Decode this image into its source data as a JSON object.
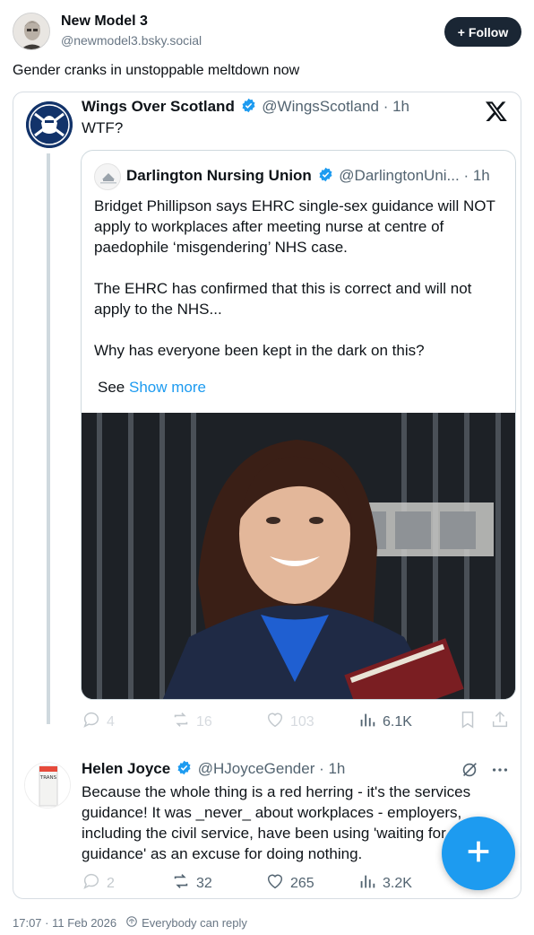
{
  "post": {
    "author_name": "New Model 3",
    "author_handle": "@newmodel3.bsky.social",
    "follow_label": "Follow",
    "text": "Gender cranks in unstoppable meltdown now",
    "timestamp": "17:07 · 11 Feb 2026",
    "reply_setting": "Everybody can reply"
  },
  "embedded_tweet": {
    "name": "Wings Over Scotland",
    "handle": "@WingsScotland",
    "age": "· 1h",
    "text": "WTF?",
    "quote": {
      "name": "Darlington Nursing Union",
      "handle": "@DarlingtonUni...",
      "age": "· 1h",
      "para1": "Bridget Phillipson says EHRC single-sex guidance will NOT apply to workplaces after meeting nurse at centre of paedophile ‘misgendering’ NHS case.",
      "para2": "The EHRC has confirmed that this is correct and will not apply to the NHS...",
      "para3": "Why has everyone been kept in the dark on this?",
      "see_label": "See",
      "show_more": "Show more"
    },
    "stats": {
      "replies": "4",
      "reposts": "16",
      "likes": "103",
      "views": "6.1K"
    }
  },
  "reply_tweet": {
    "name": "Helen Joyce",
    "handle": "@HJoyceGender",
    "age": "· 1h",
    "text": "Because the whole thing is a red herring - it's the services guidance! It was _never_ about workplaces - employers, including the civil service, have been using 'waiting for guidance' as an excuse for doing nothing.",
    "avatar_book_text": "TRANS",
    "stats": {
      "replies": "2",
      "reposts": "32",
      "likes": "265",
      "views": "3.2K"
    }
  },
  "colors": {
    "accent": "#1d9bf0",
    "follow_bg": "#1a2634",
    "muted": "#536471"
  },
  "icons": [
    "plus-icon",
    "verified-icon",
    "x-logo-icon",
    "reply-icon",
    "repost-icon",
    "like-icon",
    "views-icon",
    "bookmark-icon",
    "share-icon",
    "grok-icon",
    "more-icon",
    "globe-icon"
  ]
}
